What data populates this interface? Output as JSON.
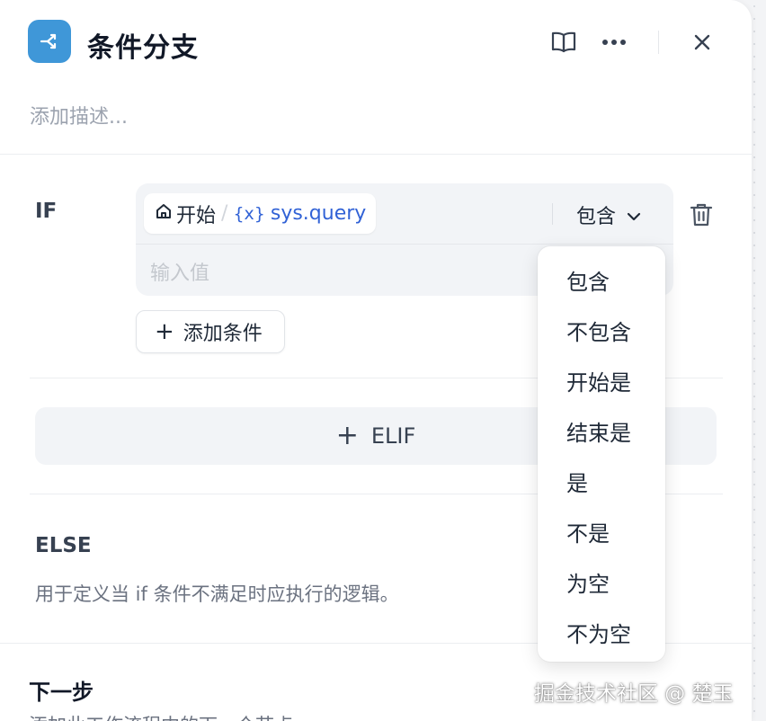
{
  "header": {
    "title": "条件分支",
    "description_placeholder": "添加描述...",
    "accent_color": "#3f97d8"
  },
  "if_block": {
    "label": "IF",
    "condition": {
      "node_name": "开始",
      "separator": "/",
      "variable_prefix": "{x}",
      "variable_name": "sys.query",
      "operator": "包含",
      "value_placeholder": "输入值"
    },
    "add_condition_label": "添加条件"
  },
  "elif_label": "ELIF",
  "else_block": {
    "title": "ELSE",
    "description": "用于定义当 if 条件不满足时应执行的逻辑。"
  },
  "next_step": {
    "title": "下一步",
    "description": "添加此工作流程中的下一个节点"
  },
  "operator_dropdown": {
    "options": [
      "包含",
      "不包含",
      "开始是",
      "结束是",
      "是",
      "不是",
      "为空",
      "不为空"
    ]
  },
  "watermark": "掘金技术社区 @ 楚玉",
  "icons": [
    "branch-icon",
    "book-icon",
    "more-icon",
    "close-icon",
    "home-icon",
    "chevron-down-icon",
    "trash-icon",
    "plus-icon"
  ]
}
